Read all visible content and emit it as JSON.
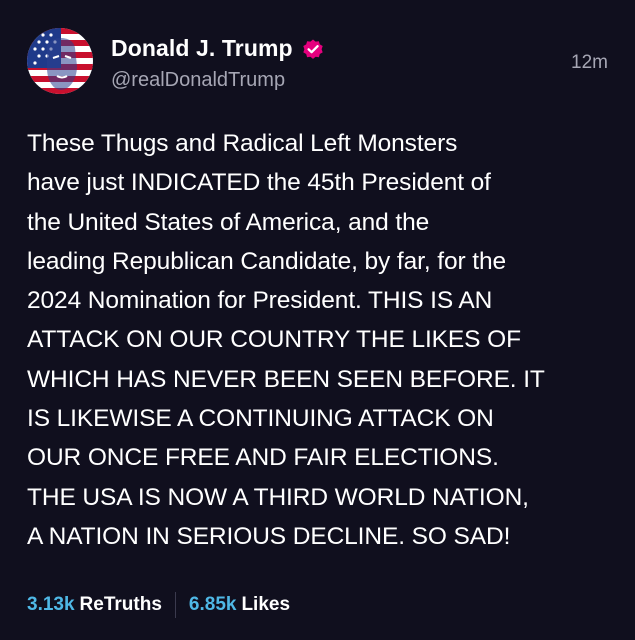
{
  "author": {
    "display_name": "Donald J. Trump",
    "handle": "@realDonaldTrump",
    "verified_icon": "verified-badge-icon",
    "avatar": "user-avatar"
  },
  "post": {
    "timestamp": "12m",
    "text": "These Thugs and Radical Left Monsters\nhave just INDICATED the 45th President of\nthe United States of America, and the\nleading Republican Candidate, by far, for the\n2024 Nomination for President. THIS IS AN\nATTACK ON OUR COUNTRY THE LIKES OF\nWHICH HAS NEVER BEEN SEEN BEFORE. IT\nIS LIKEWISE A CONTINUING ATTACK ON\nOUR ONCE FREE AND FAIR ELECTIONS.\nTHE USA IS NOW A THIRD WORLD NATION,\nA NATION IN SERIOUS DECLINE. SO SAD!"
  },
  "stats": {
    "retruths_count": "3.13k",
    "retruths_label": "ReTruths",
    "likes_count": "6.85k",
    "likes_label": "Likes"
  },
  "colors": {
    "background": "#100f1e",
    "accent": "#4fb8e6",
    "verified": "#e5007e",
    "muted_text": "#a6a6b4"
  }
}
